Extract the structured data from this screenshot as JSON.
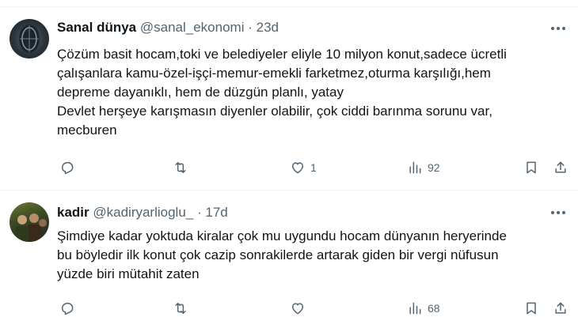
{
  "tweets": [
    {
      "display_name": "Sanal dünya",
      "handle": "@sanal_ekonomi",
      "separator": "·",
      "time": "23d",
      "lines": [
        "Çözüm basit hocam,toki ve belediyeler eliyle 10 milyon konut,sadece ücretli",
        "çalışanlara kamu-özel-işçi-memur-emekli farketmez,oturma karşılığı,hem",
        "depreme dayanıklı, hem de düzgün planlı, yatay",
        "Devlet herşeye karışmasın diyenler olabilir, çok ciddi barınma sorunu var,",
        "mecburen"
      ],
      "likes": "1",
      "views": "92"
    },
    {
      "display_name": "kadir",
      "handle": "@kadiryarlioglu_",
      "separator": "·",
      "time": "17d",
      "lines": [
        "Şimdiye kadar yoktuda kiralar çok mu uygundu hocam dünyanın heryerinde",
        "bu böyledir ilk konut çok cazip sonrakilerde artarak giden bir vergi nüfusun",
        "yüzde biri mütahit zaten"
      ],
      "likes": "",
      "views": "68"
    }
  ],
  "icons": [
    "reply-icon",
    "retweet-icon",
    "like-icon",
    "views-icon",
    "bookmark-icon",
    "share-icon",
    "more-icon"
  ],
  "colors": {
    "text": "#0f1419",
    "muted": "#536471",
    "divider": "#eff3f4",
    "background": "#ffffff"
  }
}
